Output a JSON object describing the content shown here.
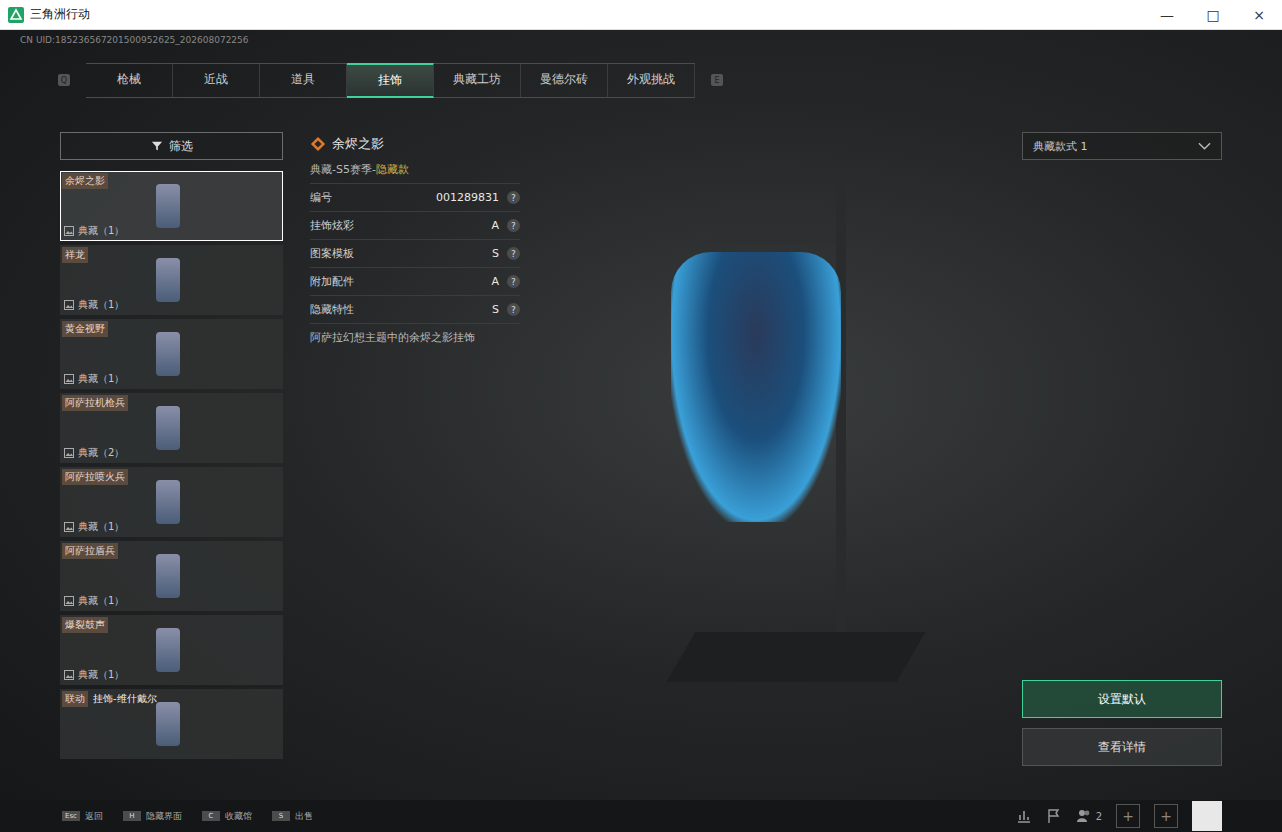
{
  "window": {
    "title": "三角洲行动",
    "controls": [
      "—",
      "□",
      "×"
    ]
  },
  "uid": "CN UID:185236567201500952625_202608072256",
  "tabs": {
    "prev_key": "Q",
    "next_key": "E",
    "items": [
      {
        "label": "枪械",
        "selected": false
      },
      {
        "label": "近战",
        "selected": false
      },
      {
        "label": "道具",
        "selected": false
      },
      {
        "label": "挂饰",
        "selected": true
      },
      {
        "label": "典藏工坊",
        "selected": false
      },
      {
        "label": "曼德尔砖",
        "selected": false
      },
      {
        "label": "外观挑战",
        "selected": false
      }
    ]
  },
  "filter": {
    "label": "筛选"
  },
  "items": [
    {
      "name": "余烬之影",
      "tag": "",
      "count": "典藏（1）",
      "selected": true
    },
    {
      "name": "祥龙",
      "tag": "",
      "count": "典藏（1）",
      "selected": false
    },
    {
      "name": "黄金视野",
      "tag": "",
      "count": "典藏（1）",
      "selected": false
    },
    {
      "name": "阿萨拉机枪兵",
      "tag": "",
      "count": "典藏（2）",
      "selected": false
    },
    {
      "name": "阿萨拉喷火兵",
      "tag": "",
      "count": "典藏（1）",
      "selected": false
    },
    {
      "name": "阿萨拉盾兵",
      "tag": "",
      "count": "典藏（1）",
      "selected": false
    },
    {
      "name": "爆裂鼓声",
      "tag": "",
      "count": "典藏（1）",
      "selected": false
    },
    {
      "name": "挂饰-维什戴尔",
      "tag": "联动",
      "count": "",
      "selected": false
    }
  ],
  "detail": {
    "title": "余烬之影",
    "subtitle": "典藏-S5赛季-",
    "hidden_label": "隐藏款",
    "rows": [
      {
        "label": "编号",
        "value": "001289831",
        "help": "?"
      },
      {
        "label": "挂饰炫彩",
        "value": "A",
        "help": "?"
      },
      {
        "label": "图案模板",
        "value": "S",
        "help": "?"
      },
      {
        "label": "附加配件",
        "value": "A",
        "help": "?"
      },
      {
        "label": "隐藏特性",
        "value": "S",
        "help": "?"
      }
    ],
    "description": "阿萨拉幻想主题中的余烬之影挂饰"
  },
  "style_select": {
    "value": "典藏款式 1"
  },
  "buttons": [
    {
      "label": "设置默认",
      "selected": true
    },
    {
      "label": "查看详情",
      "selected": false
    }
  ],
  "hints": [
    {
      "key": "Esc",
      "label": "返回"
    },
    {
      "key": "H",
      "label": "隐藏界面"
    },
    {
      "key": "C",
      "label": "收藏馆"
    },
    {
      "key": "S",
      "label": "出售"
    }
  ],
  "social": {
    "friends": "2",
    "add": [
      "+",
      "+"
    ]
  }
}
